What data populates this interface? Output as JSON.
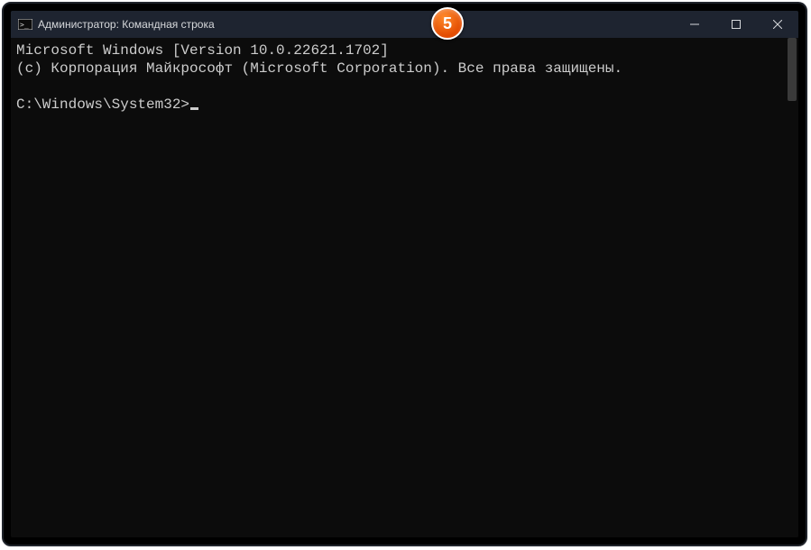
{
  "window": {
    "title": "Администратор: Командная строка"
  },
  "terminal": {
    "line1": "Microsoft Windows [Version 10.0.22621.1702]",
    "line2": "(c) Корпорация Майкрософт (Microsoft Corporation). Все права защищены.",
    "prompt": "C:\\Windows\\System32>"
  },
  "annotation": {
    "step": "5"
  }
}
